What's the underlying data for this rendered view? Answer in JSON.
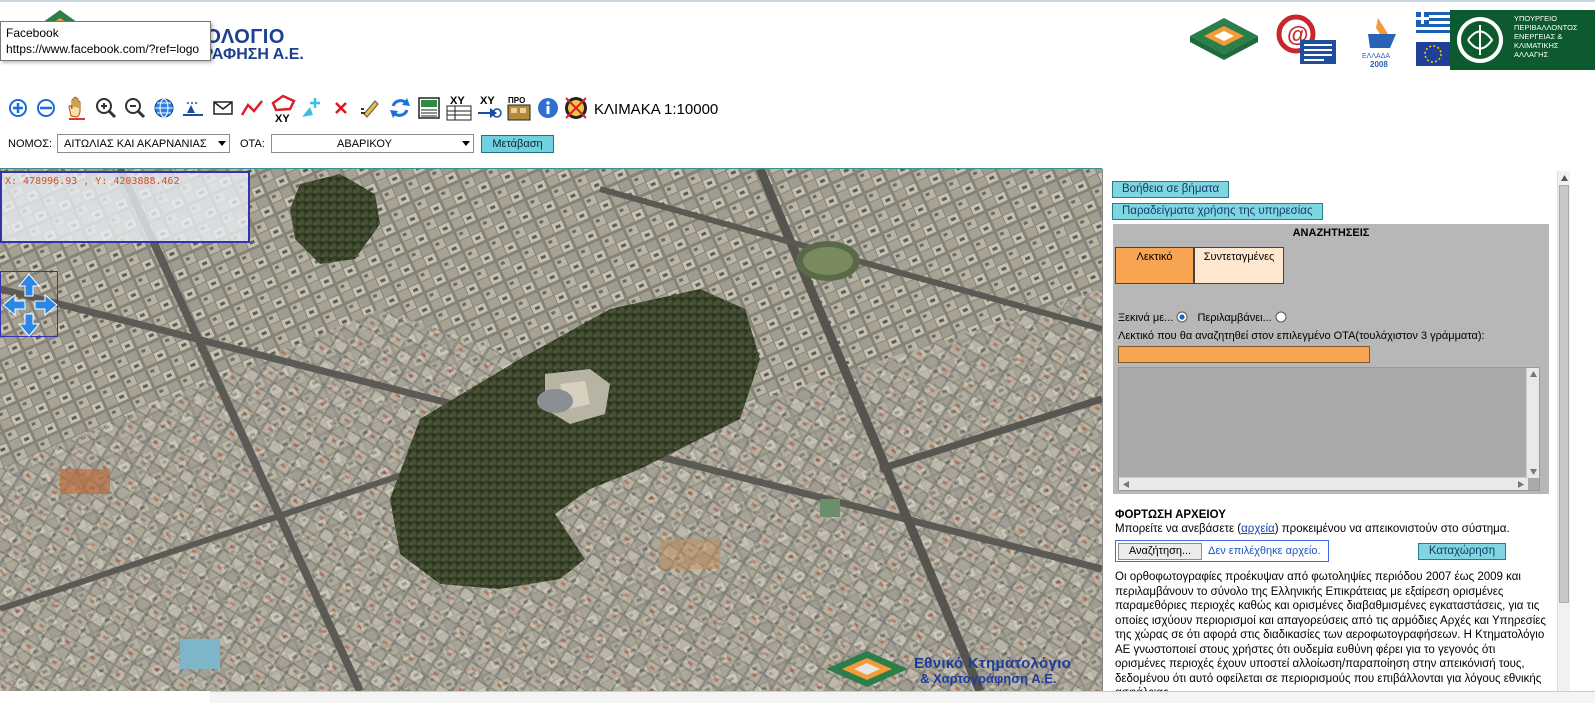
{
  "header": {
    "brand_line1": "ΚΤΗΜΑΤΟΛΟΓΙΟ",
    "brand_line2": "& ΧΑΡΤΟΓΡΑΦΗΣΗ Α.Ε.",
    "tooltip_title": "Facebook",
    "tooltip_url": "https://www.facebook.com/?ref=logo",
    "partners": {
      "ellada_text": "ΕΛΛΑΔΑ",
      "ellada_year": "2008",
      "ministry_lines": [
        "ΥΠΟΥΡΓΕΙΟ",
        "ΠΕΡΙΒΑΛΛΟΝΤΟΣ",
        "ΕΝΕΡΓΕΙΑΣ &",
        "ΚΛΙΜΑΤΙΚΗΣ",
        "ΑΛΛΑΓΗΣ"
      ]
    }
  },
  "toolbar": {
    "tools": [
      "zoom-in-plus-icon",
      "zoom-out-minus-icon",
      "pan-hand-icon",
      "zoom-in-magnifier-icon",
      "zoom-out-magnifier-icon",
      "globe-icon",
      "measure-area-icon",
      "envelope-icon",
      "draw-line-icon",
      "polygon-xy-icon",
      "add-point-icon",
      "clear-cross-icon",
      "edit-pencil-icon",
      "refresh-icon",
      "print-icon",
      "xy-table-icon",
      "xy-goto-icon",
      "legend-icon",
      "info-icon",
      "disable-icon"
    ],
    "xy_label": "XY",
    "pro_label": "ΠΡΟ",
    "scale_label": "ΚΛΙΜΑΚΑ 1:10000"
  },
  "selects": {
    "nomos_label": "ΝΟΜΟΣ:",
    "nomos_value": "ΑΙΤΩΛΙΑΣ ΚΑΙ ΑΚΑΡΝΑΝΙΑΣ",
    "ota_label": "ΟΤΑ:",
    "ota_value": "ΑΒΑΡΙΚΟΥ",
    "go_button": "Μετάβαση"
  },
  "map": {
    "coordinates": "X: 478996.93 , Y: 4203888.462",
    "logo_line1": "Εθνικό Κτηματολόγιο",
    "logo_line2": "& Χαρτογράφηση Α.Ε."
  },
  "panel": {
    "help_button": "Βοήθεια σε βήματα",
    "examples_button": "Παραδείγματα χρήσης της υπηρεσίας",
    "search_title": "ΑΝΑΖΗΤΗΣΕΙΣ",
    "tab_text": "Λεκτικό",
    "tab_coords": "Συντεταγμένες",
    "radio_starts": "Ξεκινά με...",
    "radio_contains": "Περιλαμβάνει...",
    "search_hint": "Λεκτικό που θα αναζητηθεί στον επιλεγμένο ΟΤΑ(τουλάχιστον 3 γράμματα):",
    "search_value": "",
    "upload_title": "ΦΟΡΤΩΣΗ ΑΡΧΕΙΟΥ",
    "upload_text_before": "Μπορείτε να ανεβάσετε (",
    "upload_link": "αρχεία",
    "upload_text_after": ") προκειμένου να απεικονιστούν στο σύστημα.",
    "browse_button": "Αναζήτηση...",
    "no_file": "Δεν επιλέχθηκε αρχείο.",
    "submit_button": "Καταχώρηση",
    "disclaimer": "Οι ορθοφωτογραφίες προέκυψαν από φωτοληψίες περιόδου 2007 έως 2009 και περιλαμβάνουν το σύνολο της Ελληνικής Επικράτειας με εξαίρεση ορισμένες παραμεθόριες περιοχές καθώς και ορισμένες διαβαθμισμένες εγκαταστάσεις, για τις οποίες ισχύουν περιορισμοί και απαγορεύσεις από τις αρμόδιες Αρχές και Υπηρεσίες της χώρας σε ότι αφορά στις διαδικασίες των αεροφωτογραφήσεων. Η Κτηματολόγιο ΑΕ γνωστοποιεί στους χρήστες ότι ουδεμία ευθύνη φέρει για το γεγονός ότι ορισμένες περιοχές έχουν υποστεί αλλοίωση/παραποίηση στην απεικόνισή τους, δεδομένου ότι αυτό οφείλεται σε περιορισμούς που επιβάλλονται για λόγους εθνικής ασφάλειας."
  },
  "colors": {
    "brand_blue": "#1d3f8f",
    "button_cyan": "#7fd6e1",
    "tab_active": "#f7a550",
    "tab_inactive": "#fde7cf",
    "input_orange": "#f7a550",
    "coord_text": "#d8501e"
  }
}
